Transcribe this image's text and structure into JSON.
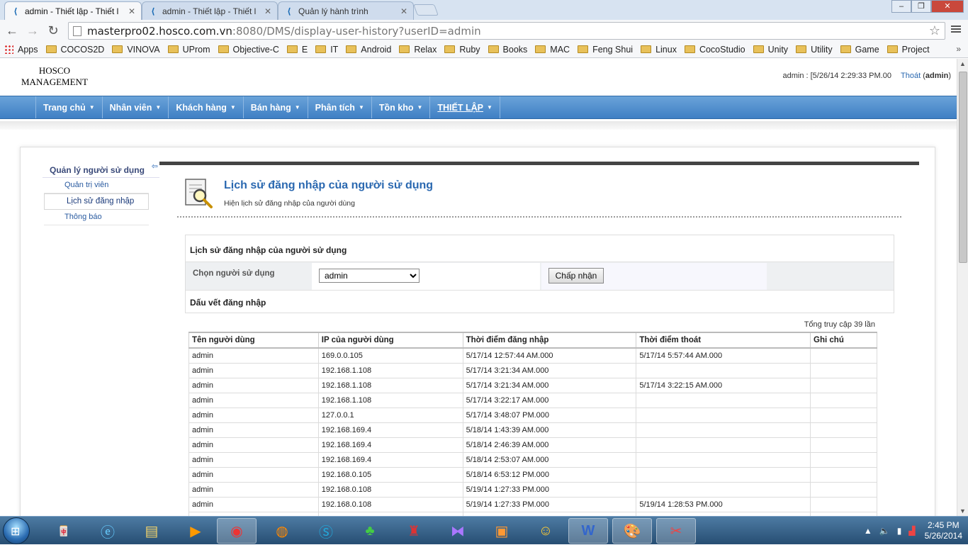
{
  "browser": {
    "tabs": [
      {
        "label": "admin - Thiết lập - Thiết l",
        "active": true
      },
      {
        "label": "admin - Thiết lập - Thiết l",
        "active": false
      },
      {
        "label": "Quản lý hành trình",
        "active": false
      }
    ],
    "url_host": "masterpro02.hosco.com.vn",
    "url_rest": ":8080/DMS/display-user-history?userID=admin",
    "bookmarks": [
      "Apps",
      "COCOS2D",
      "VINOVA",
      "UProm",
      "Objective-C",
      "E",
      "IT",
      "Android",
      "Relax",
      "Ruby",
      "Books",
      "MAC",
      "Feng Shui",
      "Linux",
      "CocoStudio",
      "Unity",
      "Utility",
      "Game",
      "Project"
    ],
    "bookmarks_more": "»"
  },
  "header": {
    "logo_line1": "HOSCO",
    "logo_line2": "MANAGEMENT",
    "session": "admin : [5/26/14 2:29:33 PM.00",
    "logout_label": "Thoát",
    "logout_user_open": "(",
    "logout_user": "admin",
    "logout_user_close": ")"
  },
  "nav": [
    {
      "label": "Trang chủ"
    },
    {
      "label": "Nhân viên"
    },
    {
      "label": "Khách hàng"
    },
    {
      "label": "Bán hàng"
    },
    {
      "label": "Phân tích"
    },
    {
      "label": "Tồn kho"
    },
    {
      "label": "THIẾT LẬP",
      "active": true
    }
  ],
  "sidebar": {
    "title": "Quản lý người sử dụng",
    "items": [
      {
        "label": "Quản trị viên"
      },
      {
        "label": "Lịch sử đăng nhập",
        "active": true
      },
      {
        "label": "Thông báo"
      }
    ]
  },
  "page": {
    "title": "Lịch sử đăng nhập của người sử dụng",
    "description": "Hiện lịch sử đăng nhập của người dùng"
  },
  "panel": {
    "title": "Lịch sử đăng nhập của người sử dụng",
    "select_label": "Chọn người sử dụng",
    "select_value": "admin",
    "submit_label": "Chấp nhận",
    "trace_title": "Dấu vết đăng nhập"
  },
  "total_label": "Tổng truy cập 39 lần",
  "table": {
    "headers": [
      "Tên người dùng",
      "IP của người dùng",
      "Thời điểm đăng nhập",
      "Thời điểm thoát",
      "Ghi chú"
    ],
    "rows": [
      [
        "admin",
        "169.0.0.105",
        "5/17/14 12:57:44 AM.000",
        "5/17/14 5:57:44 AM.000",
        ""
      ],
      [
        "admin",
        "192.168.1.108",
        "5/17/14 3:21:34 AM.000",
        "",
        ""
      ],
      [
        "admin",
        "192.168.1.108",
        "5/17/14 3:21:34 AM.000",
        "5/17/14 3:22:15 AM.000",
        ""
      ],
      [
        "admin",
        "192.168.1.108",
        "5/17/14 3:22:17 AM.000",
        "",
        ""
      ],
      [
        "admin",
        "127.0.0.1",
        "5/17/14 3:48:07 PM.000",
        "",
        ""
      ],
      [
        "admin",
        "192.168.169.4",
        "5/18/14 1:43:39 AM.000",
        "",
        ""
      ],
      [
        "admin",
        "192.168.169.4",
        "5/18/14 2:46:39 AM.000",
        "",
        ""
      ],
      [
        "admin",
        "192.168.169.4",
        "5/18/14 2:53:07 AM.000",
        "",
        ""
      ],
      [
        "admin",
        "192.168.0.105",
        "5/18/14 6:53:12 PM.000",
        "",
        ""
      ],
      [
        "admin",
        "192.168.0.108",
        "5/19/14 1:27:33 PM.000",
        "",
        ""
      ],
      [
        "admin",
        "192.168.0.108",
        "5/19/14 1:27:33 PM.000",
        "5/19/14 1:28:53 PM.000",
        ""
      ],
      [
        "",
        "",
        "",
        "",
        ""
      ]
    ]
  },
  "taskbar": {
    "time": "2:45 PM",
    "date": "5/26/2014"
  }
}
